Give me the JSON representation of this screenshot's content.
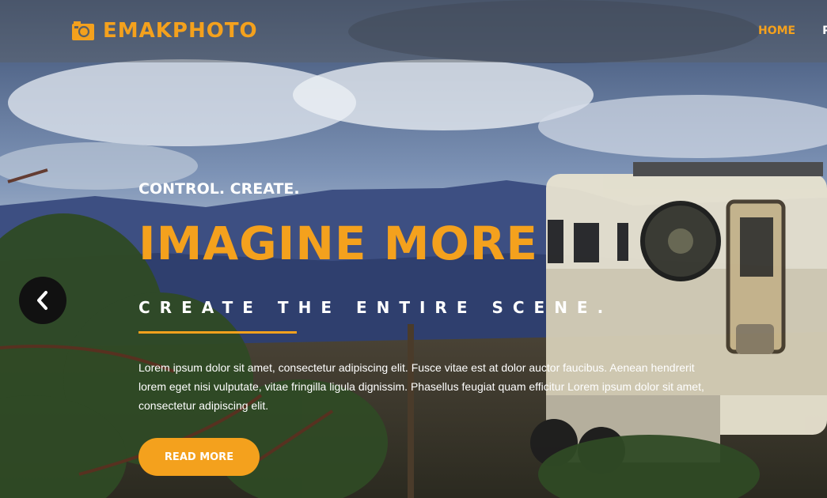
{
  "brand": {
    "name": "EMAKPHOTO",
    "color": "#f4a11d"
  },
  "nav": {
    "items": [
      {
        "label": "HOME",
        "active": true
      },
      {
        "label": "P",
        "active": false
      }
    ]
  },
  "slider": {
    "prev_icon": "chevron-left-icon"
  },
  "hero": {
    "kicker": "CONTROL. CREATE.",
    "headline": "IMAGINE MORE",
    "subheadline": "CREATE THE ENTIRE SCENE.",
    "body": "Lorem ipsum dolor sit amet, consectetur adipiscing elit. Fusce vitae est at dolor auctor faucibus. Aenean hendrerit lorem eget nisi vulputate, vitae fringilla ligula dignissim. Phasellus feugiat quam efficitur Lorem ipsum dolor sit amet, consectetur adipiscing elit.",
    "cta_label": "READ MORE"
  },
  "colors": {
    "accent": "#f4a11d",
    "text": "#ffffff"
  }
}
